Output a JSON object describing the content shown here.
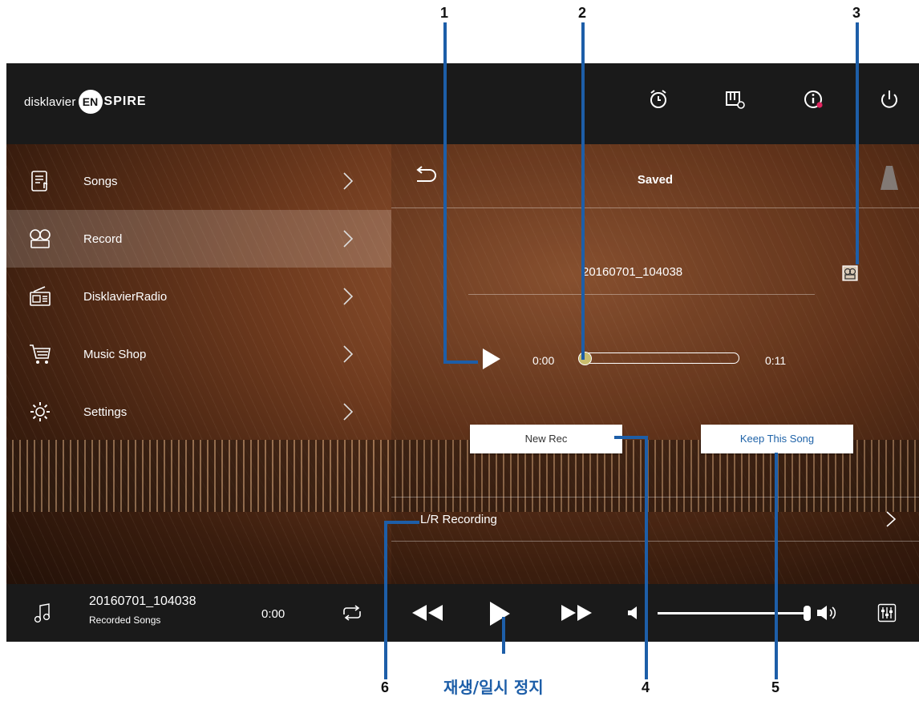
{
  "header": {
    "logo_prefix": "disklavier",
    "logo_badge": "EN",
    "logo_suffix": "SPIRE",
    "icons": [
      "alarm-clock-icon",
      "piano-settings-icon",
      "info-icon",
      "power-icon"
    ]
  },
  "sidebar": {
    "items": [
      {
        "label": "Songs",
        "icon": "songs-icon"
      },
      {
        "label": "Record",
        "icon": "record-icon",
        "active": true
      },
      {
        "label": "DisklavierRadio",
        "icon": "radio-icon"
      },
      {
        "label": "Music Shop",
        "icon": "cart-icon"
      },
      {
        "label": "Settings",
        "icon": "gear-icon"
      }
    ]
  },
  "main": {
    "title": "Saved",
    "song_name": "20160701_104038",
    "time_start": "0:00",
    "time_end": "0:11",
    "progress": 0.0,
    "new_rec_label": "New Rec",
    "keep_label": "Keep This Song",
    "lr_recording_label": "L/R Recording"
  },
  "player": {
    "title": "20160701_104038",
    "subtitle": "Recorded Songs",
    "time": "0:00",
    "volume": 0.95
  },
  "annotations": {
    "n1": "1",
    "n2": "2",
    "n3": "3",
    "n4": "4",
    "n5": "5",
    "n6": "6",
    "caption": "재생/일시 정지",
    "color": "#1d5ea8"
  }
}
